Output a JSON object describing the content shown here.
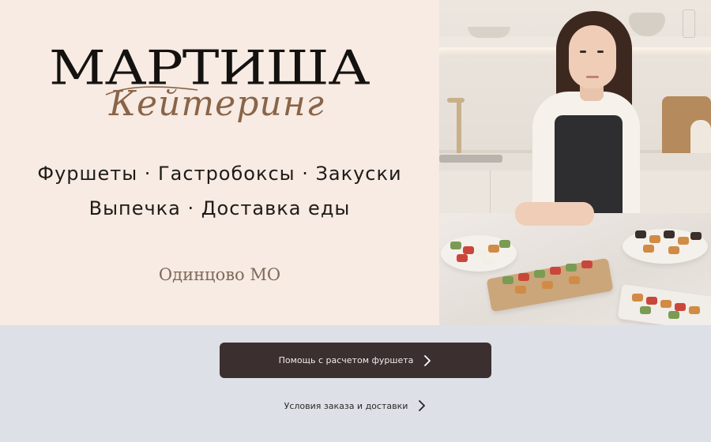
{
  "brand": {
    "name": "МАРТИША",
    "subtitle": "Кейтеринг"
  },
  "services": {
    "line1": "Фуршеты · Гастробоксы · Закуски",
    "line2": "Выпечка · Доставка еды"
  },
  "location": "Одинцово МО",
  "actions": {
    "primary_label": "Помощь с расчетом фуршета",
    "secondary_label": "Условия заказа и доставки"
  },
  "colors": {
    "hero_bg": "#f7ebe3",
    "page_bg": "#dde0e6",
    "button_bg": "#3b2f2f",
    "accent_script": "#8a6447"
  },
  "icons": {
    "primary_arrow": "chevron-right-icon",
    "secondary_arrow": "chevron-right-icon"
  }
}
